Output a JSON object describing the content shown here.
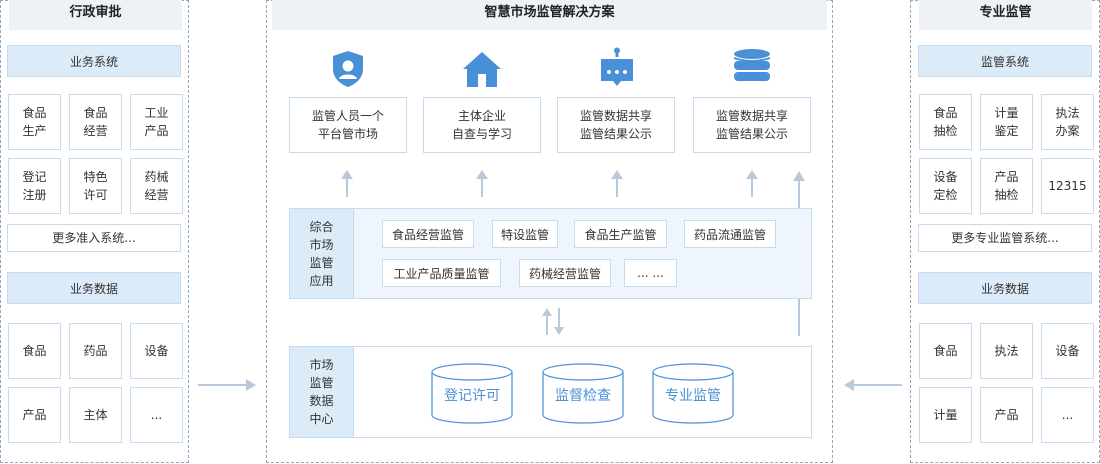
{
  "left": {
    "title": "行政审批",
    "business_header": "业务系统",
    "business_items": [
      [
        "食品",
        "生产"
      ],
      [
        "食品",
        "经营"
      ],
      [
        "工业",
        "产品"
      ],
      [
        "登记",
        "注册"
      ],
      [
        "特色",
        "许可"
      ],
      [
        "药械",
        "经营"
      ]
    ],
    "business_more": "更多准入系统...",
    "data_header": "业务数据",
    "data_items": [
      "食品",
      "药品",
      "设备",
      "产品",
      "主体",
      "..."
    ]
  },
  "center": {
    "title": "智慧市场监管解决方案",
    "top_boxes": [
      {
        "icon": "shield-user-icon",
        "lines": [
          "监管人员一个",
          "平台管市场"
        ]
      },
      {
        "icon": "home-icon",
        "lines": [
          "主体企业",
          "自查与学习"
        ]
      },
      {
        "icon": "bot-icon",
        "lines": [
          "监管数据共享",
          "监管结果公示"
        ]
      },
      {
        "icon": "database-icon",
        "lines": [
          "监管数据共享",
          "监管结果公示"
        ]
      }
    ],
    "app_label": [
      "综合",
      "市场",
      "监管",
      "应用"
    ],
    "apps_row1": [
      "食品经营监管",
      "特设监管",
      "食品生产监管",
      "药品流通监管"
    ],
    "apps_row2": [
      "工业产品质量监管",
      "药械经营监管",
      "... ..."
    ],
    "data_label": [
      "市场",
      "监管",
      "数据",
      "中心"
    ],
    "databases": [
      "登记许可",
      "监督检查",
      "专业监管"
    ],
    "accent": "#4a90d9"
  },
  "right": {
    "title": "专业监管",
    "business_header": "监管系统",
    "business_items": [
      [
        "食品",
        "抽检"
      ],
      [
        "计量",
        "鉴定"
      ],
      [
        "执法",
        "办案"
      ],
      [
        "设备",
        "定检"
      ],
      [
        "产品",
        "抽检"
      ],
      [
        "12315"
      ]
    ],
    "business_more": "更多专业监管系统...",
    "data_header": "业务数据",
    "data_items": [
      "食品",
      "执法",
      "设备",
      "计量",
      "产品",
      "..."
    ]
  }
}
